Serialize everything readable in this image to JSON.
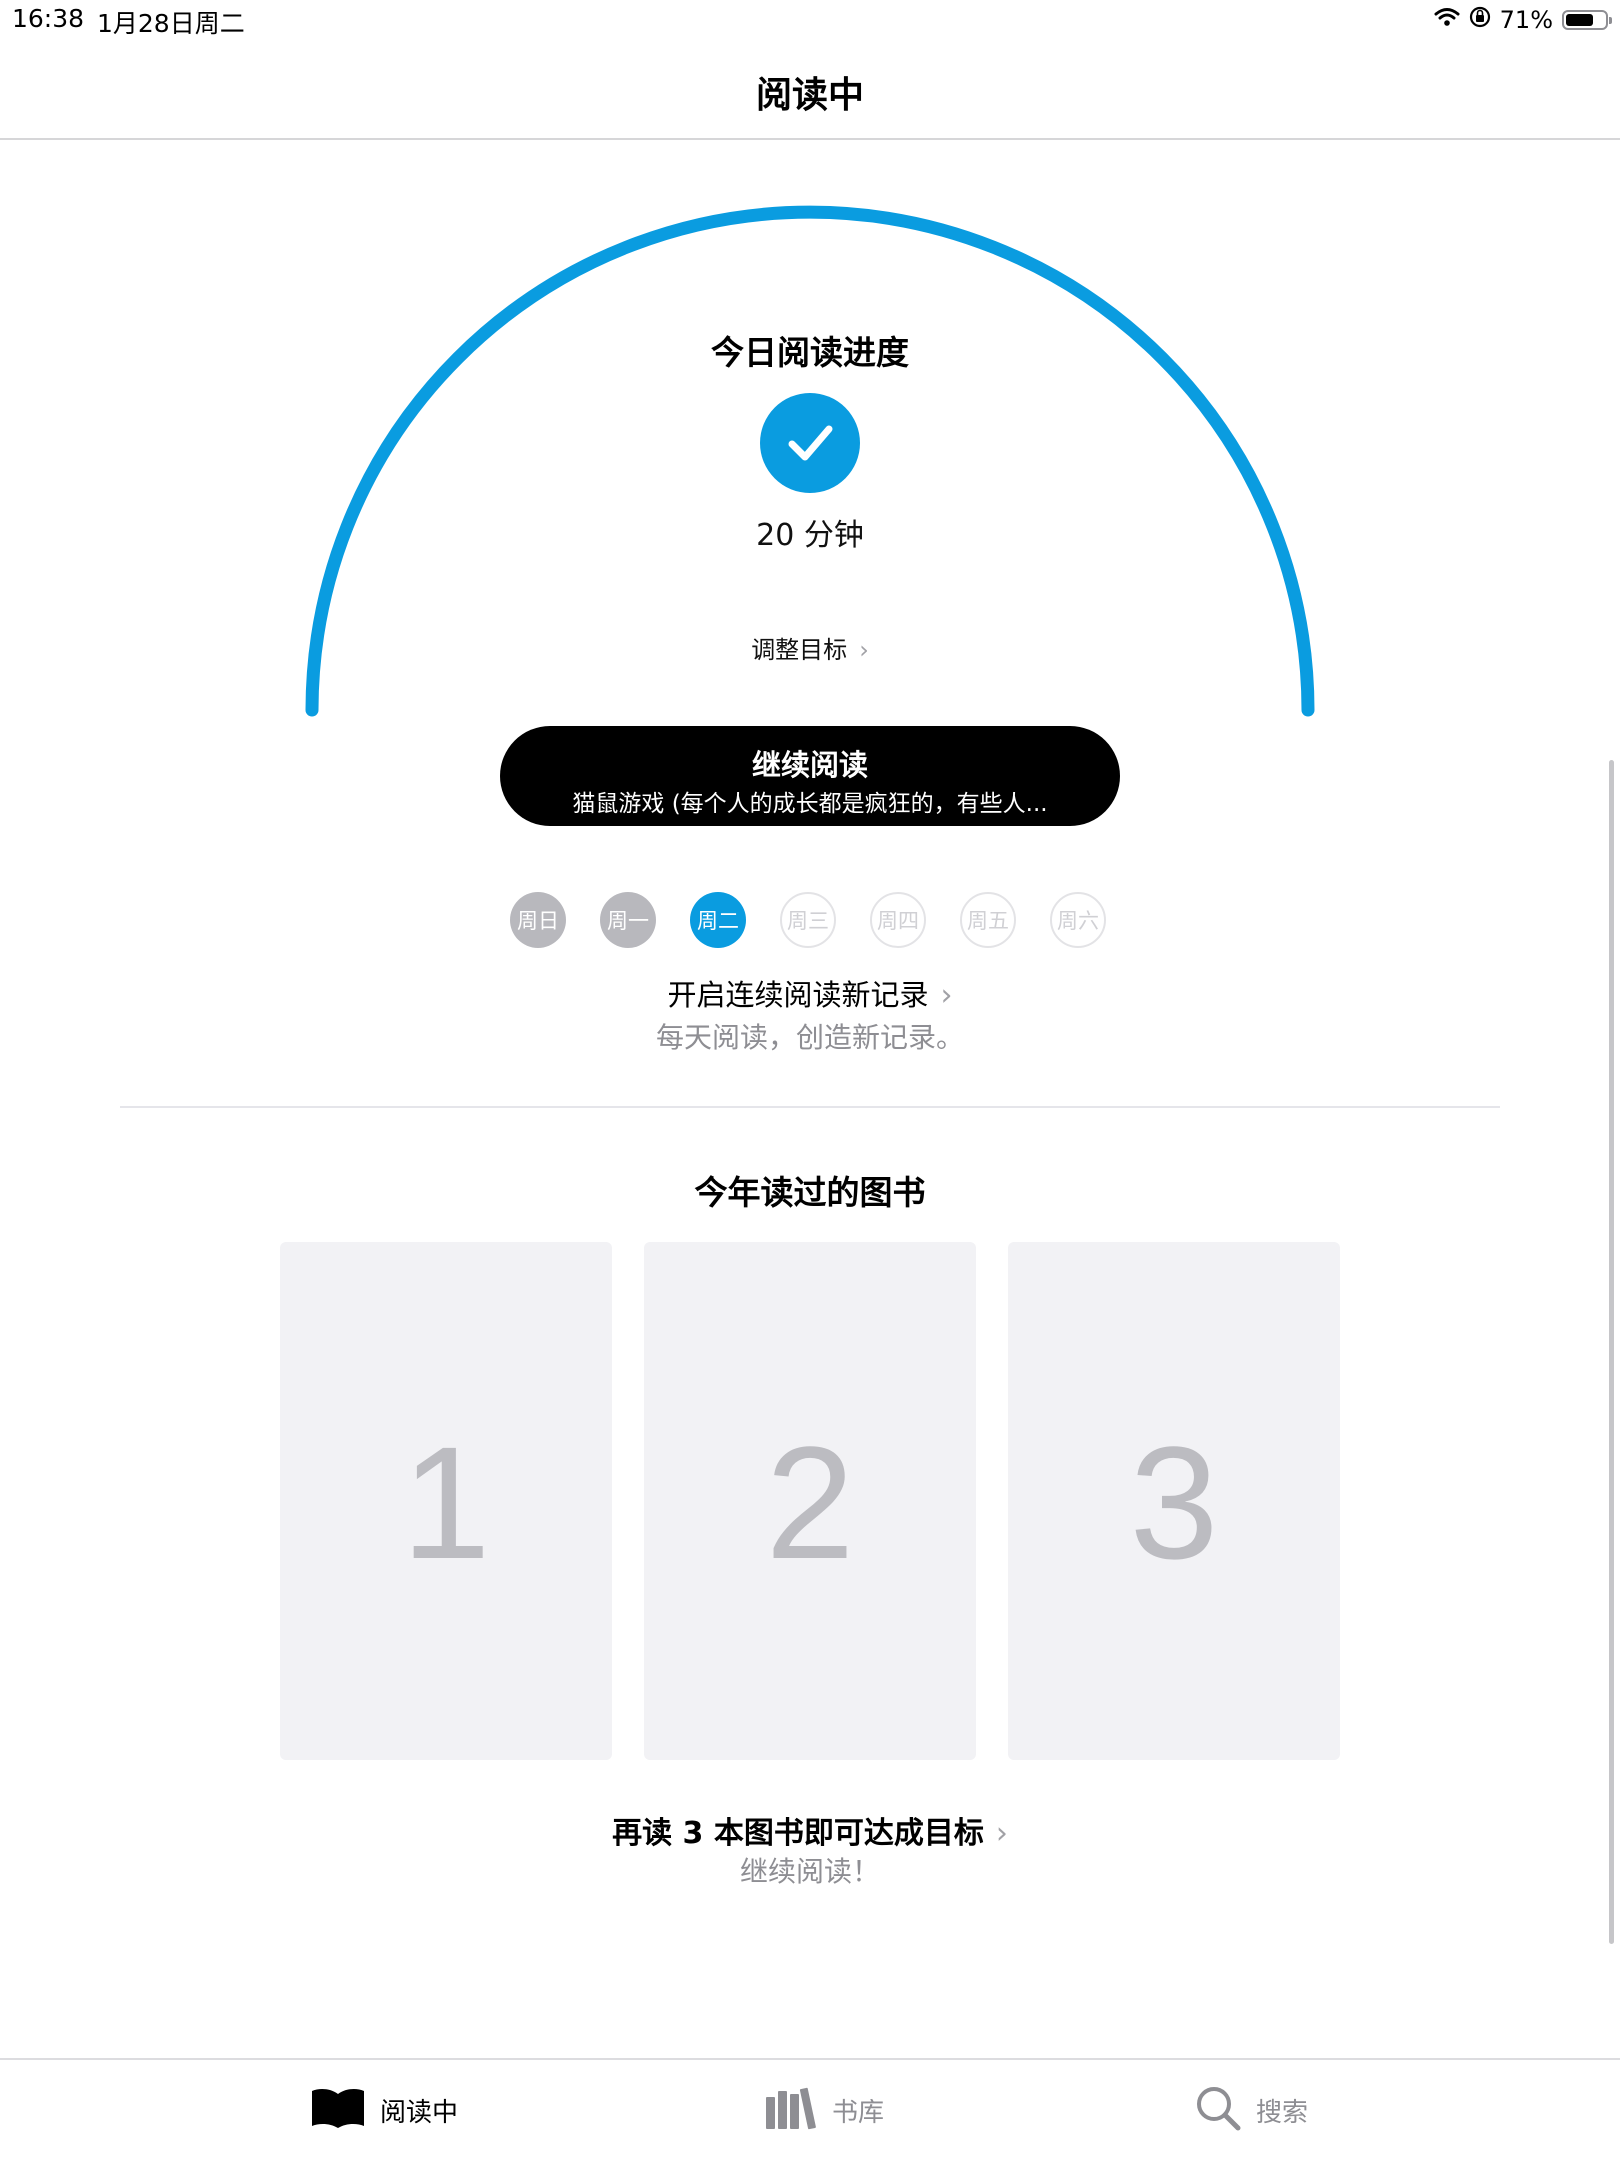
{
  "status_bar": {
    "time": "16:38",
    "date": "1月28日周二",
    "battery_percent": "71%",
    "battery_level": 0.71
  },
  "header": {
    "title": "阅读中"
  },
  "daily_progress": {
    "title": "今日阅读进度",
    "minutes_label": "20 分钟",
    "completed": true,
    "adjust_goal_label": "调整目标",
    "accent_color": "#0a9ce0"
  },
  "continue_reading": {
    "title": "继续阅读",
    "book_title": "猫鼠游戏 (每个人的成长都是疯狂的，有些人..."
  },
  "week_streak": {
    "days": [
      {
        "label": "周日",
        "state": "past"
      },
      {
        "label": "周一",
        "state": "past"
      },
      {
        "label": "周二",
        "state": "today"
      },
      {
        "label": "周三",
        "state": "future"
      },
      {
        "label": "周四",
        "state": "future"
      },
      {
        "label": "周五",
        "state": "future"
      },
      {
        "label": "周六",
        "state": "future"
      }
    ],
    "title": "开启连续阅读新记录",
    "subtitle": "每天阅读，创造新记录。"
  },
  "books_this_year": {
    "title": "今年读过的图书",
    "slots": [
      "1",
      "2",
      "3"
    ],
    "goal_title": "再读 3 本图书即可达成目标",
    "goal_subtitle": "继续阅读！"
  },
  "tab_bar": {
    "tabs": [
      {
        "label": "阅读中",
        "icon": "book-open-icon",
        "active": true
      },
      {
        "label": "书库",
        "icon": "library-icon",
        "active": false
      },
      {
        "label": "搜索",
        "icon": "search-icon",
        "active": false
      }
    ]
  }
}
